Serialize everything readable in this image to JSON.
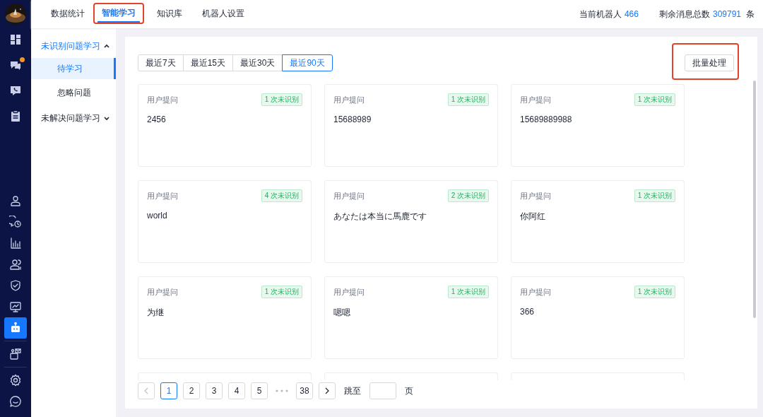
{
  "rail": {
    "items": [
      {
        "selected": false
      },
      {
        "selected": false
      },
      {
        "selected": false,
        "badge": true
      },
      {
        "selected": false
      },
      {
        "selected": false
      },
      {
        "selected": false
      },
      {
        "selected": false
      },
      {
        "selected": false
      },
      {
        "selected": false
      },
      {
        "selected": false
      },
      {
        "selected": false
      },
      {
        "selected": true
      },
      {
        "selected": false
      },
      {
        "selected": false
      },
      {
        "selected": false
      }
    ]
  },
  "top_tabs": [
    {
      "label": "数据统计",
      "selected": false,
      "highlighted": false
    },
    {
      "label": "智能学习",
      "selected": true,
      "highlighted": true
    },
    {
      "label": "知识库",
      "selected": false,
      "highlighted": false
    },
    {
      "label": "机器人设置",
      "selected": false,
      "highlighted": false
    }
  ],
  "stats": [
    {
      "label": "当前机器人",
      "value": "466"
    },
    {
      "label": "剩余消息总数",
      "value": "309791",
      "unit": "条"
    }
  ],
  "submenu": [
    {
      "label": "未识别问题学习",
      "expanded": true,
      "children": [
        {
          "label": "待学习",
          "selected": true
        },
        {
          "label": "忽略问题",
          "selected": false
        }
      ]
    },
    {
      "label": "未解决问题学习",
      "expanded": false
    }
  ],
  "filters": [
    {
      "label": "最近7天",
      "selected": false
    },
    {
      "label": "最近15天",
      "selected": false
    },
    {
      "label": "最近30天",
      "selected": false
    },
    {
      "label": "最近90天",
      "selected": true
    }
  ],
  "batch_button": {
    "label": "批量处理",
    "highlighted": true
  },
  "cards": [
    {
      "kind": "full",
      "title": "用户提问",
      "badge": "1 次未识别",
      "question": "2456"
    },
    {
      "kind": "full",
      "title": "用户提问",
      "badge": "1 次未识别",
      "question": "15688989"
    },
    {
      "kind": "full",
      "title": "用户提问",
      "badge": "1 次未识别",
      "question": "15689889988"
    },
    {
      "kind": "full",
      "title": "用户提问",
      "badge": "4 次未识别",
      "question": "world"
    },
    {
      "kind": "full",
      "title": "用户提问",
      "badge": "2 次未识别",
      "question": "あなたは本当に馬鹿です"
    },
    {
      "kind": "full",
      "title": "用户提问",
      "badge": "1 次未识别",
      "question": "你阿红"
    },
    {
      "kind": "full",
      "title": "用户提问",
      "badge": "1 次未识别",
      "question": "为继"
    },
    {
      "kind": "full",
      "title": "用户提问",
      "badge": "1 次未识别",
      "question": "嗯嗯"
    },
    {
      "kind": "full",
      "title": "用户提问",
      "badge": "1 次未识别",
      "question": "366"
    },
    {
      "kind": "clipped"
    },
    {
      "kind": "clipped"
    },
    {
      "kind": "clipped"
    }
  ],
  "pagination": {
    "prev_disabled": true,
    "pages": [
      {
        "kind": "page",
        "label": "1",
        "selected": true
      },
      {
        "kind": "page",
        "label": "2",
        "selected": false
      },
      {
        "kind": "page",
        "label": "3",
        "selected": false
      },
      {
        "kind": "page",
        "label": "4",
        "selected": false
      },
      {
        "kind": "page",
        "label": "5",
        "selected": false
      },
      {
        "kind": "ellipsis"
      },
      {
        "kind": "page",
        "label": "38",
        "selected": false
      }
    ],
    "jump_label": "跳至",
    "page_unit": "页"
  }
}
